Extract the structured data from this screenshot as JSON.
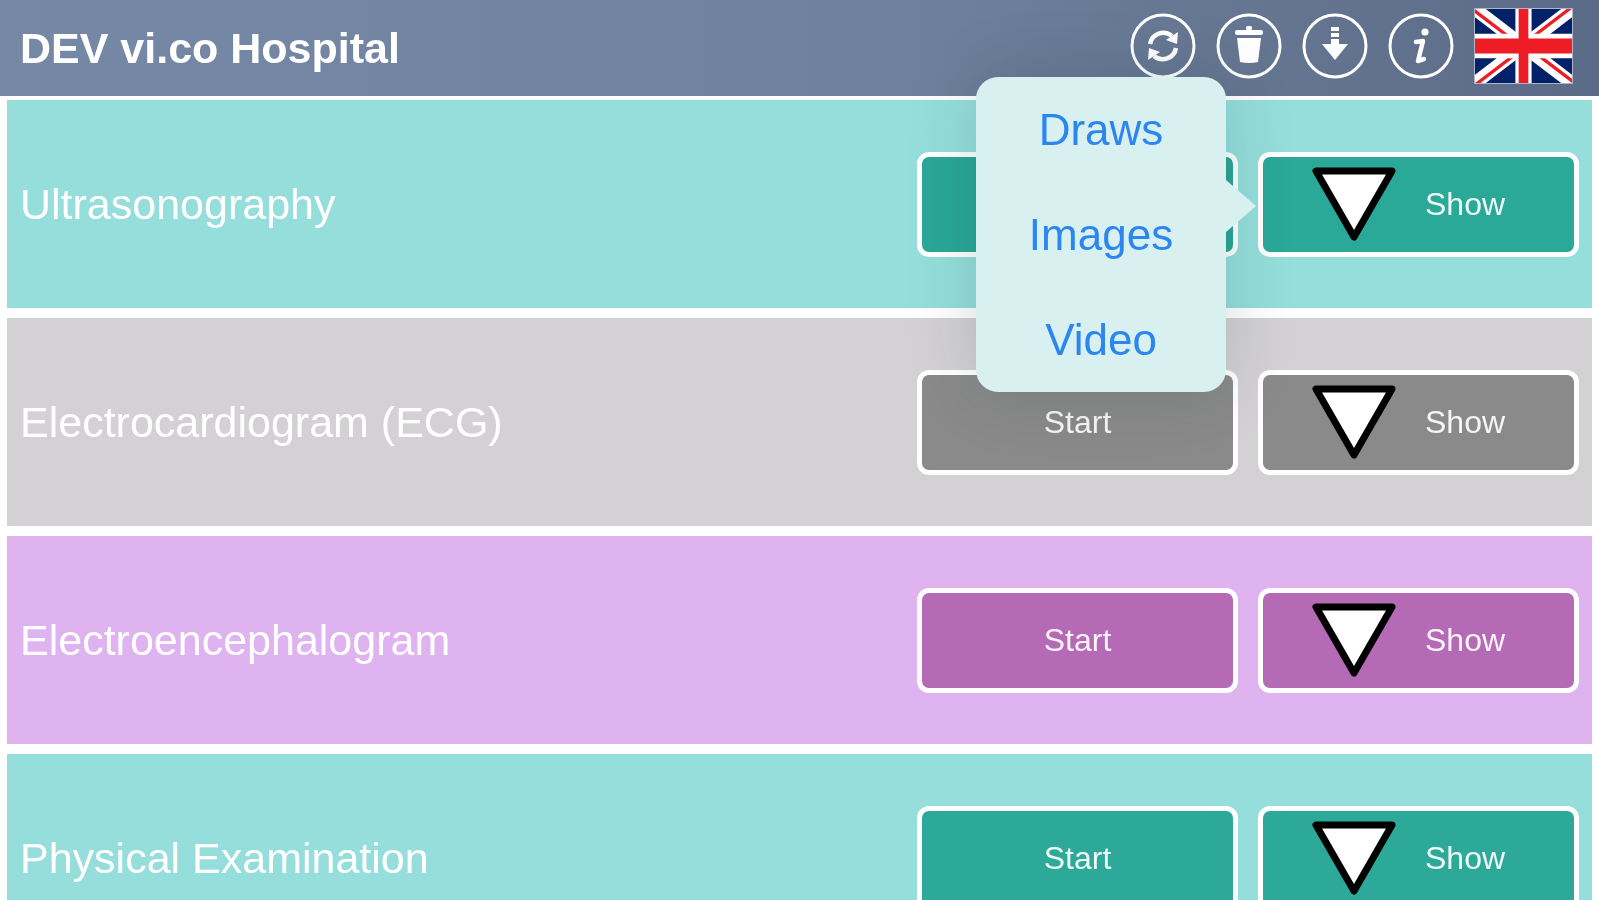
{
  "header": {
    "title": "DEV vi.co Hospital"
  },
  "rows": [
    {
      "title": "Ultrasonography",
      "color": "#95dedc",
      "start_button": {
        "color": "#2aa898"
      },
      "show_button": {
        "label": "Show",
        "color": "#2aa898"
      }
    },
    {
      "title": "Electrocardiogram (ECG)",
      "color": "#d3d1d3",
      "start_button": {
        "label": "Start",
        "color": "#8a8a8a"
      },
      "show_button": {
        "label": "Show",
        "color": "#8a8a8a"
      }
    },
    {
      "title": "Electroencephalogram",
      "color": "#dfb3ef",
      "start_button": {
        "label": "Start",
        "color": "#b56ab5"
      },
      "show_button": {
        "label": "Show",
        "color": "#b56ab5"
      }
    },
    {
      "title": "Physical Examination",
      "color": "#95dedc",
      "start_button": {
        "label": "Start",
        "color": "#2ca998"
      },
      "show_button": {
        "label": "Show",
        "color": "#2ca998"
      }
    }
  ],
  "popover": {
    "items": [
      "Draws",
      "Images",
      "Video"
    ]
  }
}
